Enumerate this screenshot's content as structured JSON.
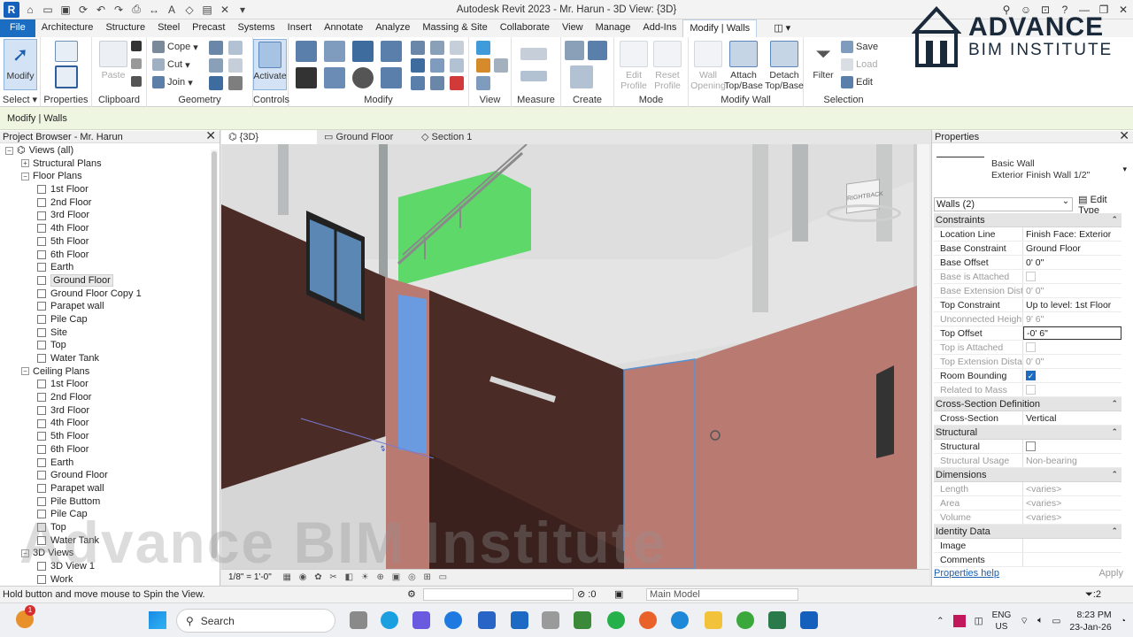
{
  "window": {
    "title": "Autodesk Revit 2023 - Mr. Harun - 3D View: {3D}",
    "logo_letter": "R"
  },
  "ribbon_tabs": [
    "File",
    "Architecture",
    "Structure",
    "Steel",
    "Precast",
    "Systems",
    "Insert",
    "Annotate",
    "Analyze",
    "Massing & Site",
    "Collaborate",
    "View",
    "Manage",
    "Add-Ins",
    "Modify | Walls"
  ],
  "ribbon": {
    "select": {
      "modify_label": "Modify",
      "panel_label": "Select"
    },
    "properties": {
      "panel_label": "Properties"
    },
    "clipboard": {
      "paste_label": "Paste",
      "panel_label": "Clipboard"
    },
    "geometry": {
      "cope_label": "Cope",
      "cut_label": "Cut",
      "join_label": "Join",
      "panel_label": "Geometry"
    },
    "controls": {
      "activate_label": "Activate",
      "panel_label": "Controls"
    },
    "modify": {
      "panel_label": "Modify"
    },
    "view": {
      "panel_label": "View"
    },
    "measure": {
      "panel_label": "Measure"
    },
    "create": {
      "panel_label": "Create"
    },
    "mode": {
      "edit_profile_label": "Edit Profile",
      "reset_profile_label": "Reset Profile",
      "panel_label": "Mode"
    },
    "modify_wall": {
      "wall_opening_label": "Wall Opening",
      "attach_label": "Attach Top/Base",
      "detach_label": "Detach Top/Base",
      "panel_label": "Modify Wall"
    },
    "selection": {
      "filter_label": "Filter",
      "save_label": "Save",
      "load_label": "Load",
      "edit_label": "Edit",
      "panel_label": "Selection"
    }
  },
  "context_bar": {
    "text": "Modify | Walls"
  },
  "browser": {
    "title": "Project Browser - Mr. Harun",
    "nodes": [
      {
        "label": "Views (all)",
        "level": 0,
        "kind": "root"
      },
      {
        "label": "Structural Plans",
        "level": 1,
        "kind": "collapsed"
      },
      {
        "label": "Floor Plans",
        "level": 1,
        "kind": "expanded"
      },
      {
        "label": "1st Floor",
        "level": 2,
        "kind": "view"
      },
      {
        "label": "2nd Floor",
        "level": 2,
        "kind": "view"
      },
      {
        "label": "3rd Floor",
        "level": 2,
        "kind": "view"
      },
      {
        "label": "4th Floor",
        "level": 2,
        "kind": "view"
      },
      {
        "label": "5th Floor",
        "level": 2,
        "kind": "view"
      },
      {
        "label": "6th Floor",
        "level": 2,
        "kind": "view"
      },
      {
        "label": "Earth",
        "level": 2,
        "kind": "view"
      },
      {
        "label": "Ground Floor",
        "level": 2,
        "kind": "view",
        "selected": true
      },
      {
        "label": "Ground Floor Copy 1",
        "level": 2,
        "kind": "view"
      },
      {
        "label": "Parapet wall",
        "level": 2,
        "kind": "view"
      },
      {
        "label": "Pile Cap",
        "level": 2,
        "kind": "view"
      },
      {
        "label": "Site",
        "level": 2,
        "kind": "view"
      },
      {
        "label": "Top",
        "level": 2,
        "kind": "view"
      },
      {
        "label": "Water Tank",
        "level": 2,
        "kind": "view"
      },
      {
        "label": "Ceiling Plans",
        "level": 1,
        "kind": "expanded"
      },
      {
        "label": "1st Floor",
        "level": 2,
        "kind": "view"
      },
      {
        "label": "2nd Floor",
        "level": 2,
        "kind": "view"
      },
      {
        "label": "3rd Floor",
        "level": 2,
        "kind": "view"
      },
      {
        "label": "4th Floor",
        "level": 2,
        "kind": "view"
      },
      {
        "label": "5th Floor",
        "level": 2,
        "kind": "view"
      },
      {
        "label": "6th Floor",
        "level": 2,
        "kind": "view"
      },
      {
        "label": "Earth",
        "level": 2,
        "kind": "view"
      },
      {
        "label": "Ground Floor",
        "level": 2,
        "kind": "view"
      },
      {
        "label": "Parapet wall",
        "level": 2,
        "kind": "view"
      },
      {
        "label": "Pile Buttom",
        "level": 2,
        "kind": "view"
      },
      {
        "label": "Pile Cap",
        "level": 2,
        "kind": "view"
      },
      {
        "label": "Top",
        "level": 2,
        "kind": "view"
      },
      {
        "label": "Water Tank",
        "level": 2,
        "kind": "view"
      },
      {
        "label": "3D Views",
        "level": 1,
        "kind": "expanded"
      },
      {
        "label": "3D View 1",
        "level": 2,
        "kind": "view"
      },
      {
        "label": "Work",
        "level": 2,
        "kind": "view"
      }
    ]
  },
  "view_tabs": [
    {
      "label": "{3D}",
      "active": true
    },
    {
      "label": "Ground Floor",
      "active": false
    },
    {
      "label": "Section 1",
      "active": false
    }
  ],
  "view_cube": {
    "right": "RIGHT",
    "back": "BACK"
  },
  "view_bar": {
    "scale": "1/8\" = 1'-0\""
  },
  "properties": {
    "title": "Properties",
    "type_family": "Basic Wall",
    "type_name": "Exterior Finish Wall 1/2\"",
    "instance_selector": "Walls (2)",
    "edit_type_label": "Edit Type",
    "groups": [
      {
        "name": "Constraints",
        "rows": [
          {
            "key": "Location Line",
            "value": "Finish Face: Exterior"
          },
          {
            "key": "Base Constraint",
            "value": "Ground Floor"
          },
          {
            "key": "Base Offset",
            "value": "0'  0\""
          },
          {
            "key": "Base is Attached",
            "value": "",
            "checkbox": false,
            "dim": true
          },
          {
            "key": "Base Extension Dist...",
            "value": "0'  0\"",
            "dim": true
          },
          {
            "key": "Top Constraint",
            "value": "Up to level: 1st Floor"
          },
          {
            "key": "Unconnected Height",
            "value": "9'  6\"",
            "dim": true
          },
          {
            "key": "Top Offset",
            "value": "-0'  6\"",
            "editing": true
          },
          {
            "key": "Top is Attached",
            "value": "",
            "checkbox": false,
            "dim": true
          },
          {
            "key": "Top Extension Dista...",
            "value": "0'  0\"",
            "dim": true
          },
          {
            "key": "Room Bounding",
            "value": "",
            "checkbox": true
          },
          {
            "key": "Related to Mass",
            "value": "",
            "checkbox": false,
            "dim": true
          }
        ]
      },
      {
        "name": "Cross-Section Definition",
        "rows": [
          {
            "key": "Cross-Section",
            "value": "Vertical"
          }
        ]
      },
      {
        "name": "Structural",
        "rows": [
          {
            "key": "Structural",
            "value": "",
            "checkbox": false
          },
          {
            "key": "Structural Usage",
            "value": "Non-bearing",
            "dim": true
          }
        ]
      },
      {
        "name": "Dimensions",
        "rows": [
          {
            "key": "Length",
            "value": "<varies>",
            "dim": true
          },
          {
            "key": "Area",
            "value": "<varies>",
            "dim": true
          },
          {
            "key": "Volume",
            "value": "<varies>",
            "dim": true
          }
        ]
      },
      {
        "name": "Identity Data",
        "rows": [
          {
            "key": "Image",
            "value": ""
          },
          {
            "key": "Comments",
            "value": ""
          }
        ]
      }
    ],
    "help_link": "Properties help",
    "apply_label": "Apply"
  },
  "status_bar": {
    "message": "Hold button and move mouse to Spin the View.",
    "zero": ":0",
    "model": "Main Model",
    "filter_count": ":2"
  },
  "taskbar": {
    "search_placeholder": "Search",
    "lang1": "ENG",
    "lang2": "US",
    "time": "8:23 PM",
    "date": "23-Jan-26",
    "badge": "1"
  },
  "watermarks": {
    "logo_line1": "ADVANCE",
    "logo_line2": "BIM INSTITUTE",
    "center_text": "Advance BIM Institute"
  },
  "colors": {
    "accent": "#1b6dc1",
    "context_bar": "#eef5e1",
    "wall_dark": "#4a2b26",
    "wall_light": "#b97a72",
    "glass": "#5fd86a"
  }
}
